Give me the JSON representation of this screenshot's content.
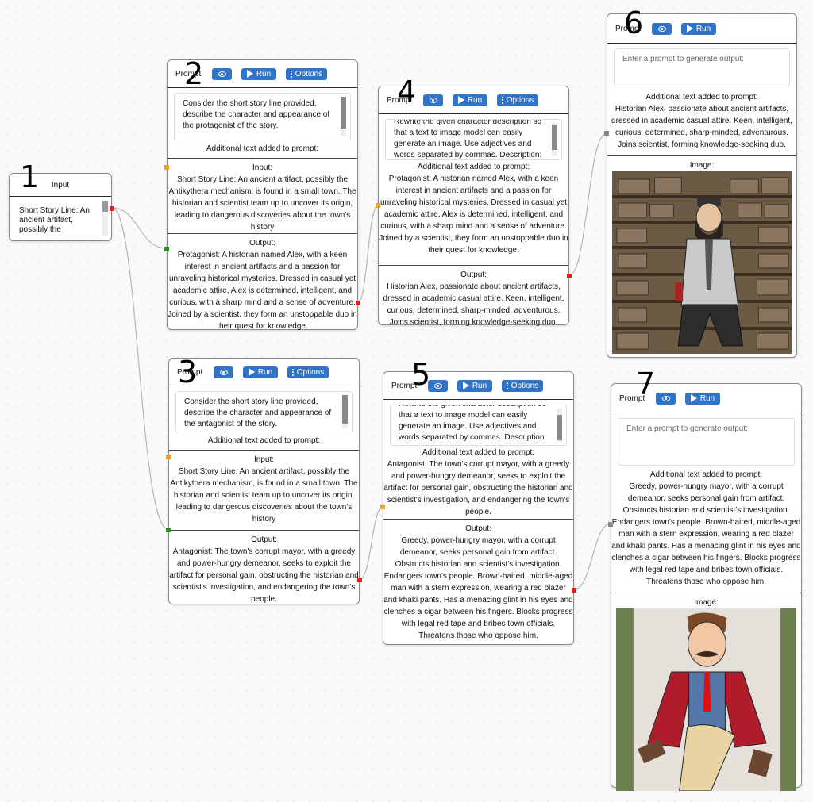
{
  "common": {
    "prompt_label": "Prompt",
    "run_label": "Run",
    "options_label": "Options",
    "additional_label": "Additional text added to prompt:",
    "input_label": "Input:",
    "output_label": "Output:",
    "image_label": "Image:",
    "placeholder": "Enter a prompt to generate output:"
  },
  "badges": [
    "1",
    "2",
    "3",
    "4",
    "5",
    "6",
    "7"
  ],
  "node1": {
    "title": "Input",
    "text": "Short Story Line: An ancient artifact, possibly the"
  },
  "node2": {
    "prompt_text": "Consider the short story line provided, describe the character and appearance of the protagonist of the story.",
    "input_text": "Short Story Line: An ancient artifact, possibly the Antikythera mechanism, is found in a small town. The historian and scientist team up to uncover its origin, leading to dangerous discoveries about the town's history",
    "output_text": "Protagonist: A historian named Alex, with a keen interest in ancient artifacts and a passion for unraveling historical mysteries. Dressed in casual yet academic attire, Alex is determined, intelligent, and curious, with a sharp mind and a sense of adventure. Joined by a scientist, they form an unstoppable duo in their quest for knowledge."
  },
  "node3": {
    "prompt_text": "Consider the short story line provided, describe the character and appearance of the antagonist of the story.",
    "input_text": "Short Story Line: An ancient artifact, possibly the Antikythera mechanism, is found in a small town. The historian and scientist team up to uncover its origin, leading to dangerous discoveries about the town's history",
    "output_text": "Antagonist: The town's corrupt mayor, with a greedy and power-hungry demeanor, seeks to exploit the artifact for personal gain, obstructing the historian and scientist's investigation, and endangering the town's people."
  },
  "node4": {
    "prompt_text": "Rewrite the given character description so that a text to image model can easily generate an image. Use adjectives and words separated by commas. Description:",
    "additional_text": "Protagonist: A historian named Alex, with a keen interest in ancient artifacts and a passion for unraveling historical mysteries. Dressed in casual yet academic attire, Alex is determined, intelligent, and curious, with a sharp mind and a sense of adventure. Joined by a scientist, they form an unstoppable duo in their quest for knowledge.",
    "output_text": "Historian Alex, passionate about ancient artifacts, dressed in academic casual attire. Keen, intelligent, curious, determined, sharp-minded, adventurous. Joins scientist, forming knowledge-seeking duo."
  },
  "node5": {
    "prompt_text": "Rewrite the given character description so that a text to image model can easily generate an image. Use adjectives and words separated by commas. Description:",
    "additional_text": "Antagonist: The town's corrupt mayor, with a greedy and power-hungry demeanor, seeks to exploit the artifact for personal gain, obstructing the historian and scientist's investigation, and endangering the town's people.",
    "output_text": "Greedy, power-hungry mayor, with a corrupt demeanor, seeks personal gain from artifact. Obstructs historian and scientist's investigation. Endangers town's people. Brown-haired, middle-aged man with a stern expression, wearing a red blazer and khaki pants. Has a menacing glint in his eyes and clenches a cigar between his fingers. Blocks progress with legal red tape and bribes town officials. Threatens those who oppose him."
  },
  "node6": {
    "additional_text": "Historian Alex, passionate about ancient artifacts, dressed in academic casual attire. Keen, intelligent, curious, determined, sharp-minded, adventurous. Joins scientist, forming knowledge-seeking duo."
  },
  "node7": {
    "additional_text": "Greedy, power-hungry mayor, with a corrupt demeanor, seeks personal gain from artifact. Obstructs historian and scientist's investigation. Endangers town's people. Brown-haired, middle-aged man with a stern expression, wearing a red blazer and khaki pants. Has a menacing glint in his eyes and clenches a cigar between his fingers. Blocks progress with legal red tape and bribes town officials. Threatens those who oppose him."
  },
  "colors": {
    "button": "#2f74c9",
    "port_out": "#e02020",
    "port_in_orange": "#f0a020",
    "port_in_green": "#2a8a2a",
    "port_gray": "#888888"
  }
}
